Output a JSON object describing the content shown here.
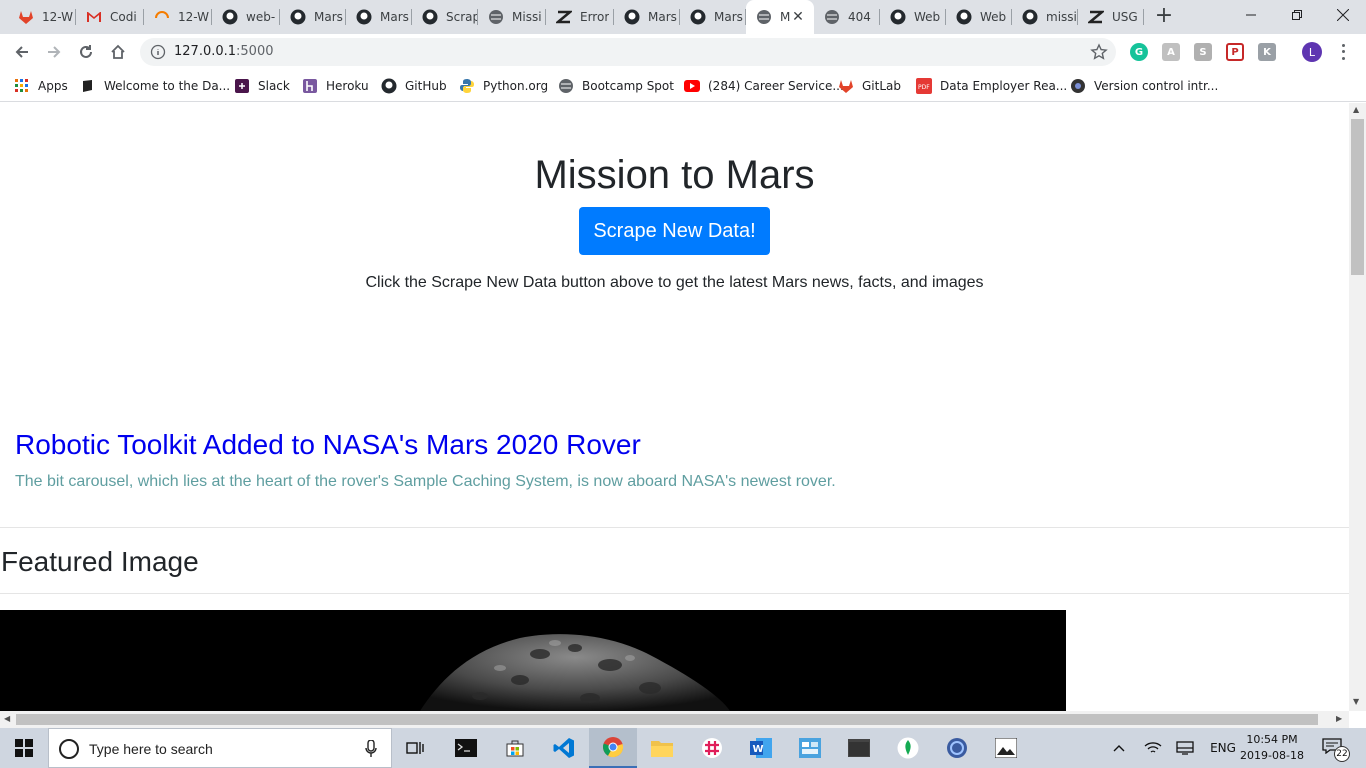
{
  "browser": {
    "tabs": [
      {
        "label": "12-W",
        "icon": "gitlab-icon"
      },
      {
        "label": "Codi",
        "icon": "gmail-icon"
      },
      {
        "label": "12-W",
        "icon": "loading-icon"
      },
      {
        "label": "web-",
        "icon": "github-icon"
      },
      {
        "label": "Mars",
        "icon": "github-icon"
      },
      {
        "label": "Mars",
        "icon": "github-icon"
      },
      {
        "label": "Scrap",
        "icon": "github-icon"
      },
      {
        "label": "Missi",
        "icon": "globe-icon"
      },
      {
        "label": "Error",
        "icon": "zendesk-icon"
      },
      {
        "label": "Mars",
        "icon": "github-icon"
      },
      {
        "label": "Mars",
        "icon": "github-icon"
      },
      {
        "label": "M",
        "icon": "globe-icon",
        "active": true
      },
      {
        "label": "404",
        "icon": "globe-icon"
      },
      {
        "label": "Web",
        "icon": "github-icon"
      },
      {
        "label": "Web",
        "icon": "github-icon"
      },
      {
        "label": "missi",
        "icon": "github-icon"
      },
      {
        "label": "USG",
        "icon": "zendesk-icon"
      }
    ],
    "url_host": "127.0.0.1",
    "url_port": ":5000",
    "profile_initial": "L",
    "bookmarks": [
      {
        "label": "Apps",
        "icon": "apps-grid-icon"
      },
      {
        "label": "Welcome to the Da...",
        "icon": "book-icon"
      },
      {
        "label": "Slack",
        "icon": "slack-icon"
      },
      {
        "label": "Heroku",
        "icon": "heroku-icon"
      },
      {
        "label": "GitHub",
        "icon": "github-icon"
      },
      {
        "label": "Python.org",
        "icon": "python-icon"
      },
      {
        "label": "Bootcamp Spot",
        "icon": "globe-icon"
      },
      {
        "label": "(284) Career Service...",
        "icon": "youtube-icon"
      },
      {
        "label": "GitLab",
        "icon": "gitlab-icon"
      },
      {
        "label": "Data Employer Rea...",
        "icon": "pdf-icon"
      },
      {
        "label": "Version control intr...",
        "icon": "git-globe-icon"
      }
    ]
  },
  "page": {
    "title": "Mission to Mars",
    "scrape_button": "Scrape New Data!",
    "instructions": "Click the Scrape New Data button above to get the latest Mars news, facts, and images",
    "news_title": "Robotic Toolkit Added to NASA's Mars 2020 Rover",
    "news_teaser": "The bit carousel, which lies at the heart of the rover's Sample Caching System, is now aboard NASA's newest rover.",
    "featured_heading": "Featured Image"
  },
  "taskbar": {
    "search_placeholder": "Type here to search",
    "language": "ENG",
    "time": "10:54 PM",
    "date": "2019-08-18",
    "notification_count": "22"
  },
  "colors": {
    "primary_button": "#007bff",
    "news_link": "#0000ee",
    "teaser": "#5f9ea0"
  }
}
